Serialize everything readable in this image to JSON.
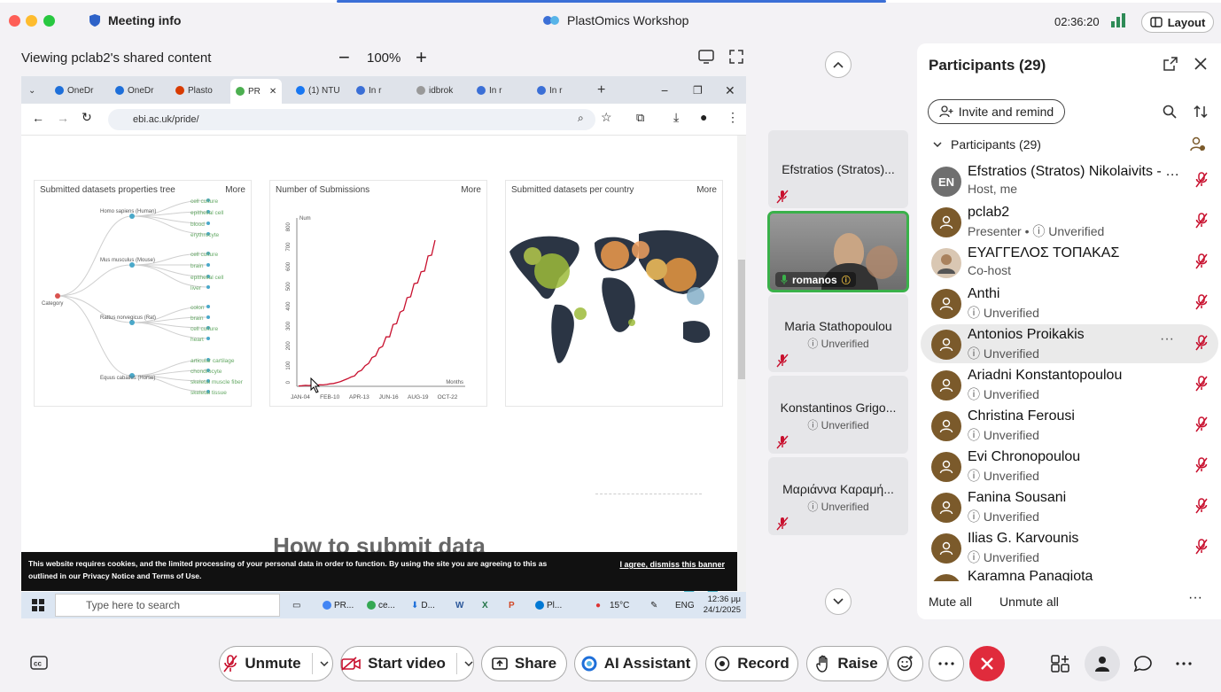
{
  "window": {
    "meeting_info": "Meeting info",
    "title": "PlastOmics Workshop",
    "clock": "02:36:20",
    "layout_label": "Layout"
  },
  "viewer": {
    "viewing_text": "Viewing pclab2's shared content",
    "zoom": "100%"
  },
  "shared_screen": {
    "tabs": [
      "OneDr",
      "OneDr",
      "Plasto",
      "PR",
      "(1) NTU",
      "In r",
      "idbrok",
      "In r",
      "In r"
    ],
    "url": "ebi.ac.uk/pride/",
    "cards": [
      {
        "title": "Submitted datasets properties tree",
        "more": "More"
      },
      {
        "title": "Number of Submissions",
        "more": "More"
      },
      {
        "title": "Submitted datasets per country",
        "more": "More"
      }
    ],
    "tree": {
      "root": "Category",
      "species": [
        "Homo sapiens (Human)",
        "Mus musculus (Mouse)",
        "Rattus norvegicus (Rat)",
        "Equus caballus (Horse)"
      ],
      "leaves": [
        "cell culture",
        "epithelial cell",
        "blood",
        "erythrocyte",
        "cell culture",
        "brain",
        "epithelial cell",
        "liver",
        "colon",
        "brain",
        "cell culture",
        "heart",
        "articular cartilage",
        "chondrocyte",
        "skeletal muscle fiber",
        "skeletal tissue"
      ]
    },
    "chart_data": {
      "type": "line",
      "title": "Number of Submissions",
      "xlabel": "Months",
      "ylabel": "Num",
      "x_ticks": [
        "JAN-04",
        "FEB-10",
        "APR-13",
        "JUN-16",
        "AUG-19",
        "OCT-22"
      ],
      "y_ticks": [
        0,
        100,
        200,
        300,
        400,
        500,
        600,
        700,
        800
      ],
      "ylim": [
        0,
        850
      ],
      "series": [
        {
          "values": [
            2,
            3,
            5,
            4,
            6,
            5,
            8,
            7,
            10,
            12,
            15,
            18,
            25,
            30,
            40,
            45,
            55,
            70,
            85,
            100,
            120,
            140,
            160,
            185,
            210,
            240,
            260,
            300,
            330,
            360,
            400,
            430,
            470,
            500,
            540,
            560,
            600,
            640,
            680,
            720
          ],
          "color": "#c8102e"
        }
      ]
    },
    "how_to": "How to submit data",
    "cookie_text_1": "This website requires cookies, and the limited processing of your personal data in order to function. By using the site you are agreeing to this as",
    "cookie_text_2": "outlined in our Privacy Notice and Terms of Use.",
    "cookie_agree": "I agree, dismiss this banner",
    "taskbar": {
      "search": "Type here to search",
      "apps": [
        "PR...",
        "ce...",
        "D...",
        "Pl..."
      ],
      "weather": "15°C",
      "lang": "ENG",
      "time": "12:36 μμ",
      "date": "24/1/2025"
    }
  },
  "video_strip": {
    "tiles": [
      {
        "name": "Efstratios (Stratos)...",
        "sub": ""
      },
      {
        "name": "Maria Stathopoulou",
        "sub": "Unverified"
      },
      {
        "name": "Konstantinos Grigo...",
        "sub": "Unverified"
      },
      {
        "name": "Μαριάννα Καραμή...",
        "sub": "Unverified"
      }
    ],
    "video_label": "romanos"
  },
  "participants": {
    "title": "Participants (29)",
    "invite_label": "Invite and remind",
    "list_header": "Participants (29)",
    "rows": [
      {
        "initials": "EN",
        "name": "Efstratios (Stratos) Nikolaivits - N...",
        "sub": "Host, me"
      },
      {
        "initials": "",
        "name": "pclab2",
        "sub": "Presenter • ⓘ Unverified"
      },
      {
        "initials": "",
        "name": "ΕΥΑΓΓΕΛΟΣ ΤΟΠΑΚΑΣ",
        "sub": "Co-host"
      },
      {
        "initials": "",
        "name": "Anthi",
        "sub": "ⓘ Unverified"
      },
      {
        "initials": "",
        "name": "Antonios Proikakis",
        "sub": "ⓘ Unverified"
      },
      {
        "initials": "",
        "name": "Ariadni Konstantopoulou",
        "sub": "ⓘ Unverified"
      },
      {
        "initials": "",
        "name": "Christina Ferousi",
        "sub": "ⓘ Unverified"
      },
      {
        "initials": "",
        "name": "Evi Chronopoulou",
        "sub": "ⓘ Unverified"
      },
      {
        "initials": "",
        "name": "Fanina Sousani",
        "sub": "ⓘ Unverified"
      },
      {
        "initials": "",
        "name": "Ilias G. Karvounis",
        "sub": "ⓘ Unverified"
      },
      {
        "initials": "",
        "name": "Karamna Panagiota",
        "sub": ""
      }
    ],
    "mute_all": "Mute all",
    "unmute_all": "Unmute all"
  },
  "controls": {
    "unmute": "Unmute",
    "start_video": "Start video",
    "share": "Share",
    "ai_assistant": "AI Assistant",
    "record": "Record",
    "raise": "Raise"
  },
  "colors": {
    "accent_blue": "#3b6fd6",
    "end_call": "#e02b3c",
    "mute_red": "#c8102e",
    "active_speaker": "#3ab14a"
  }
}
